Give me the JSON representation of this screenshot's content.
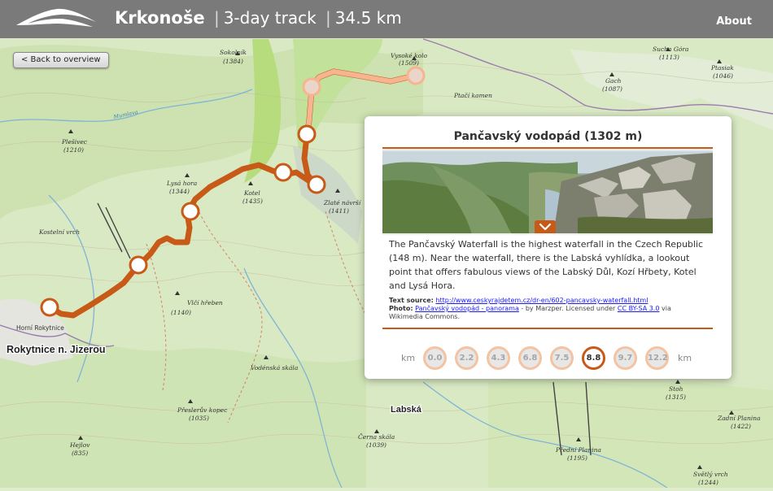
{
  "header": {
    "logo_icon": "mountain-logo-icon",
    "title": "Krkonoše",
    "subtitle": "3-day track",
    "distance": "34.5 km",
    "separator": "|",
    "about": "About"
  },
  "back_button": {
    "label": "< Back to overview"
  },
  "map": {
    "labels": [
      {
        "id": "sokolnik",
        "text": "Sokolník",
        "kind": "peak-name"
      },
      {
        "id": "sokolnik-elev",
        "text": "(1384)",
        "kind": "peak-elev"
      },
      {
        "id": "vysoke-kolo",
        "text": "Vysoké kolo",
        "kind": "peak-name"
      },
      {
        "id": "vysoke-kolo-elev",
        "text": "(1509)",
        "kind": "peak-elev"
      },
      {
        "id": "sucha-hora",
        "text": "Sucha Góra",
        "kind": "peak-name"
      },
      {
        "id": "sucha-hora-elev",
        "text": "(1113)",
        "kind": "peak-elev"
      },
      {
        "id": "ptasiak",
        "text": "Ptasiak",
        "kind": "peak-name"
      },
      {
        "id": "ptasiak-elev",
        "text": "(1046)",
        "kind": "peak-elev"
      },
      {
        "id": "gach",
        "text": "Gach",
        "kind": "peak-name"
      },
      {
        "id": "gach-elev",
        "text": "(1087)",
        "kind": "peak-elev"
      },
      {
        "id": "ptaci-kamen",
        "text": "Ptačí kamen",
        "kind": "peak-name"
      },
      {
        "id": "mumlava",
        "text": "Mumlava",
        "kind": "river"
      },
      {
        "id": "plesivec",
        "text": "Plešivec",
        "kind": "peak-name"
      },
      {
        "id": "plesivec-elev",
        "text": "(1210)",
        "kind": "peak-elev"
      },
      {
        "id": "lysa-hora",
        "text": "Lysá hora",
        "kind": "peak-name"
      },
      {
        "id": "lysa-hora-elev",
        "text": "(1344)",
        "kind": "peak-elev"
      },
      {
        "id": "kotel",
        "text": "Kotel",
        "kind": "peak-name"
      },
      {
        "id": "kotel-elev",
        "text": "(1435)",
        "kind": "peak-elev"
      },
      {
        "id": "zlate-navrsi",
        "text": "Zlaté návrší",
        "kind": "peak-name"
      },
      {
        "id": "zlate-navrsi-elev",
        "text": "(1411)",
        "kind": "peak-elev"
      },
      {
        "id": "kostelni-vrch",
        "text": "Kostelní vrch",
        "kind": "peak-name"
      },
      {
        "id": "horni-rokytnice",
        "text": "Horní Rokytnice",
        "kind": "locality"
      },
      {
        "id": "rokytnice",
        "text": "Rokytnice n. Jizerou",
        "kind": "town"
      },
      {
        "id": "vlcí-hreben",
        "text": "Vlčí hřeben",
        "kind": "peak-name"
      },
      {
        "id": "vlcí-hreben-elev",
        "text": "(1140)",
        "kind": "peak-elev"
      },
      {
        "id": "vodenska",
        "text": "Vodénská skála",
        "kind": "peak-name"
      },
      {
        "id": "labska",
        "text": "Labská",
        "kind": "town"
      },
      {
        "id": "preslerova",
        "text": "Přeslerův kopec",
        "kind": "peak-name"
      },
      {
        "id": "preslerova-elev",
        "text": "(1035)",
        "kind": "peak-elev"
      },
      {
        "id": "hejlov",
        "text": "Hejlov",
        "kind": "peak-name"
      },
      {
        "id": "hejlov-elev",
        "text": "(835)",
        "kind": "peak-elev"
      },
      {
        "id": "cerna-skala",
        "text": "Černa skála",
        "kind": "peak-name"
      },
      {
        "id": "cerna-skala-elev",
        "text": "(1039)",
        "kind": "peak-elev"
      },
      {
        "id": "predni-planina",
        "text": "Přední Planina",
        "kind": "peak-name"
      },
      {
        "id": "predni-planina-elev",
        "text": "(1195)",
        "kind": "peak-elev"
      },
      {
        "id": "stoh",
        "text": "Stoh",
        "kind": "peak-name"
      },
      {
        "id": "stoh-elev",
        "text": "(1315)",
        "kind": "peak-elev"
      },
      {
        "id": "zadni-planina",
        "text": "Zadní Planina",
        "kind": "peak-name"
      },
      {
        "id": "zadni-planina-elev",
        "text": "(1422)",
        "kind": "peak-elev"
      },
      {
        "id": "svetly-vrch",
        "text": "Světlý vrch",
        "kind": "peak-name"
      },
      {
        "id": "svetly-vrch-elev",
        "text": "(1244)",
        "kind": "peak-elev"
      }
    ]
  },
  "panel": {
    "title": "Pančavský vodopád (1302 m)",
    "expand_icon": "chevron-down-icon",
    "description": "The Pančavský Waterfall is the highest waterfall in the Czech Republic (148 m). Near the waterfall, there is the Labská vyhlídka, a lookout point that offers fabulous views of the Labský Důl, Kozí Hřbety, Kotel and Lysá Hora.",
    "text_source_label": "Text source:",
    "text_source_link": "http://www.ceskyrajdetem.cz/dr-en/602-pancavsky-waterfall.html",
    "photo_label": "Photo:",
    "photo_link": "Pančavský vodopád - panorama",
    "photo_by": " - by Marzper. Licensed under ",
    "license_link": "CC BY-SA 3.0",
    "photo_via": " via Wikimedia Commons.",
    "km_unit": "km",
    "km_points": [
      "0.0",
      "2.2",
      "4.3",
      "6.8",
      "7.5",
      "8.8",
      "9.7",
      "12.2"
    ],
    "active_km": "8.8"
  },
  "colors": {
    "track": "#c85a17",
    "track_light": "#f7b491",
    "header_bg": "#7a7a7a",
    "map_green": "#dfeccd",
    "forest": "#cfe3b3",
    "meadow": "#b9dd84"
  }
}
